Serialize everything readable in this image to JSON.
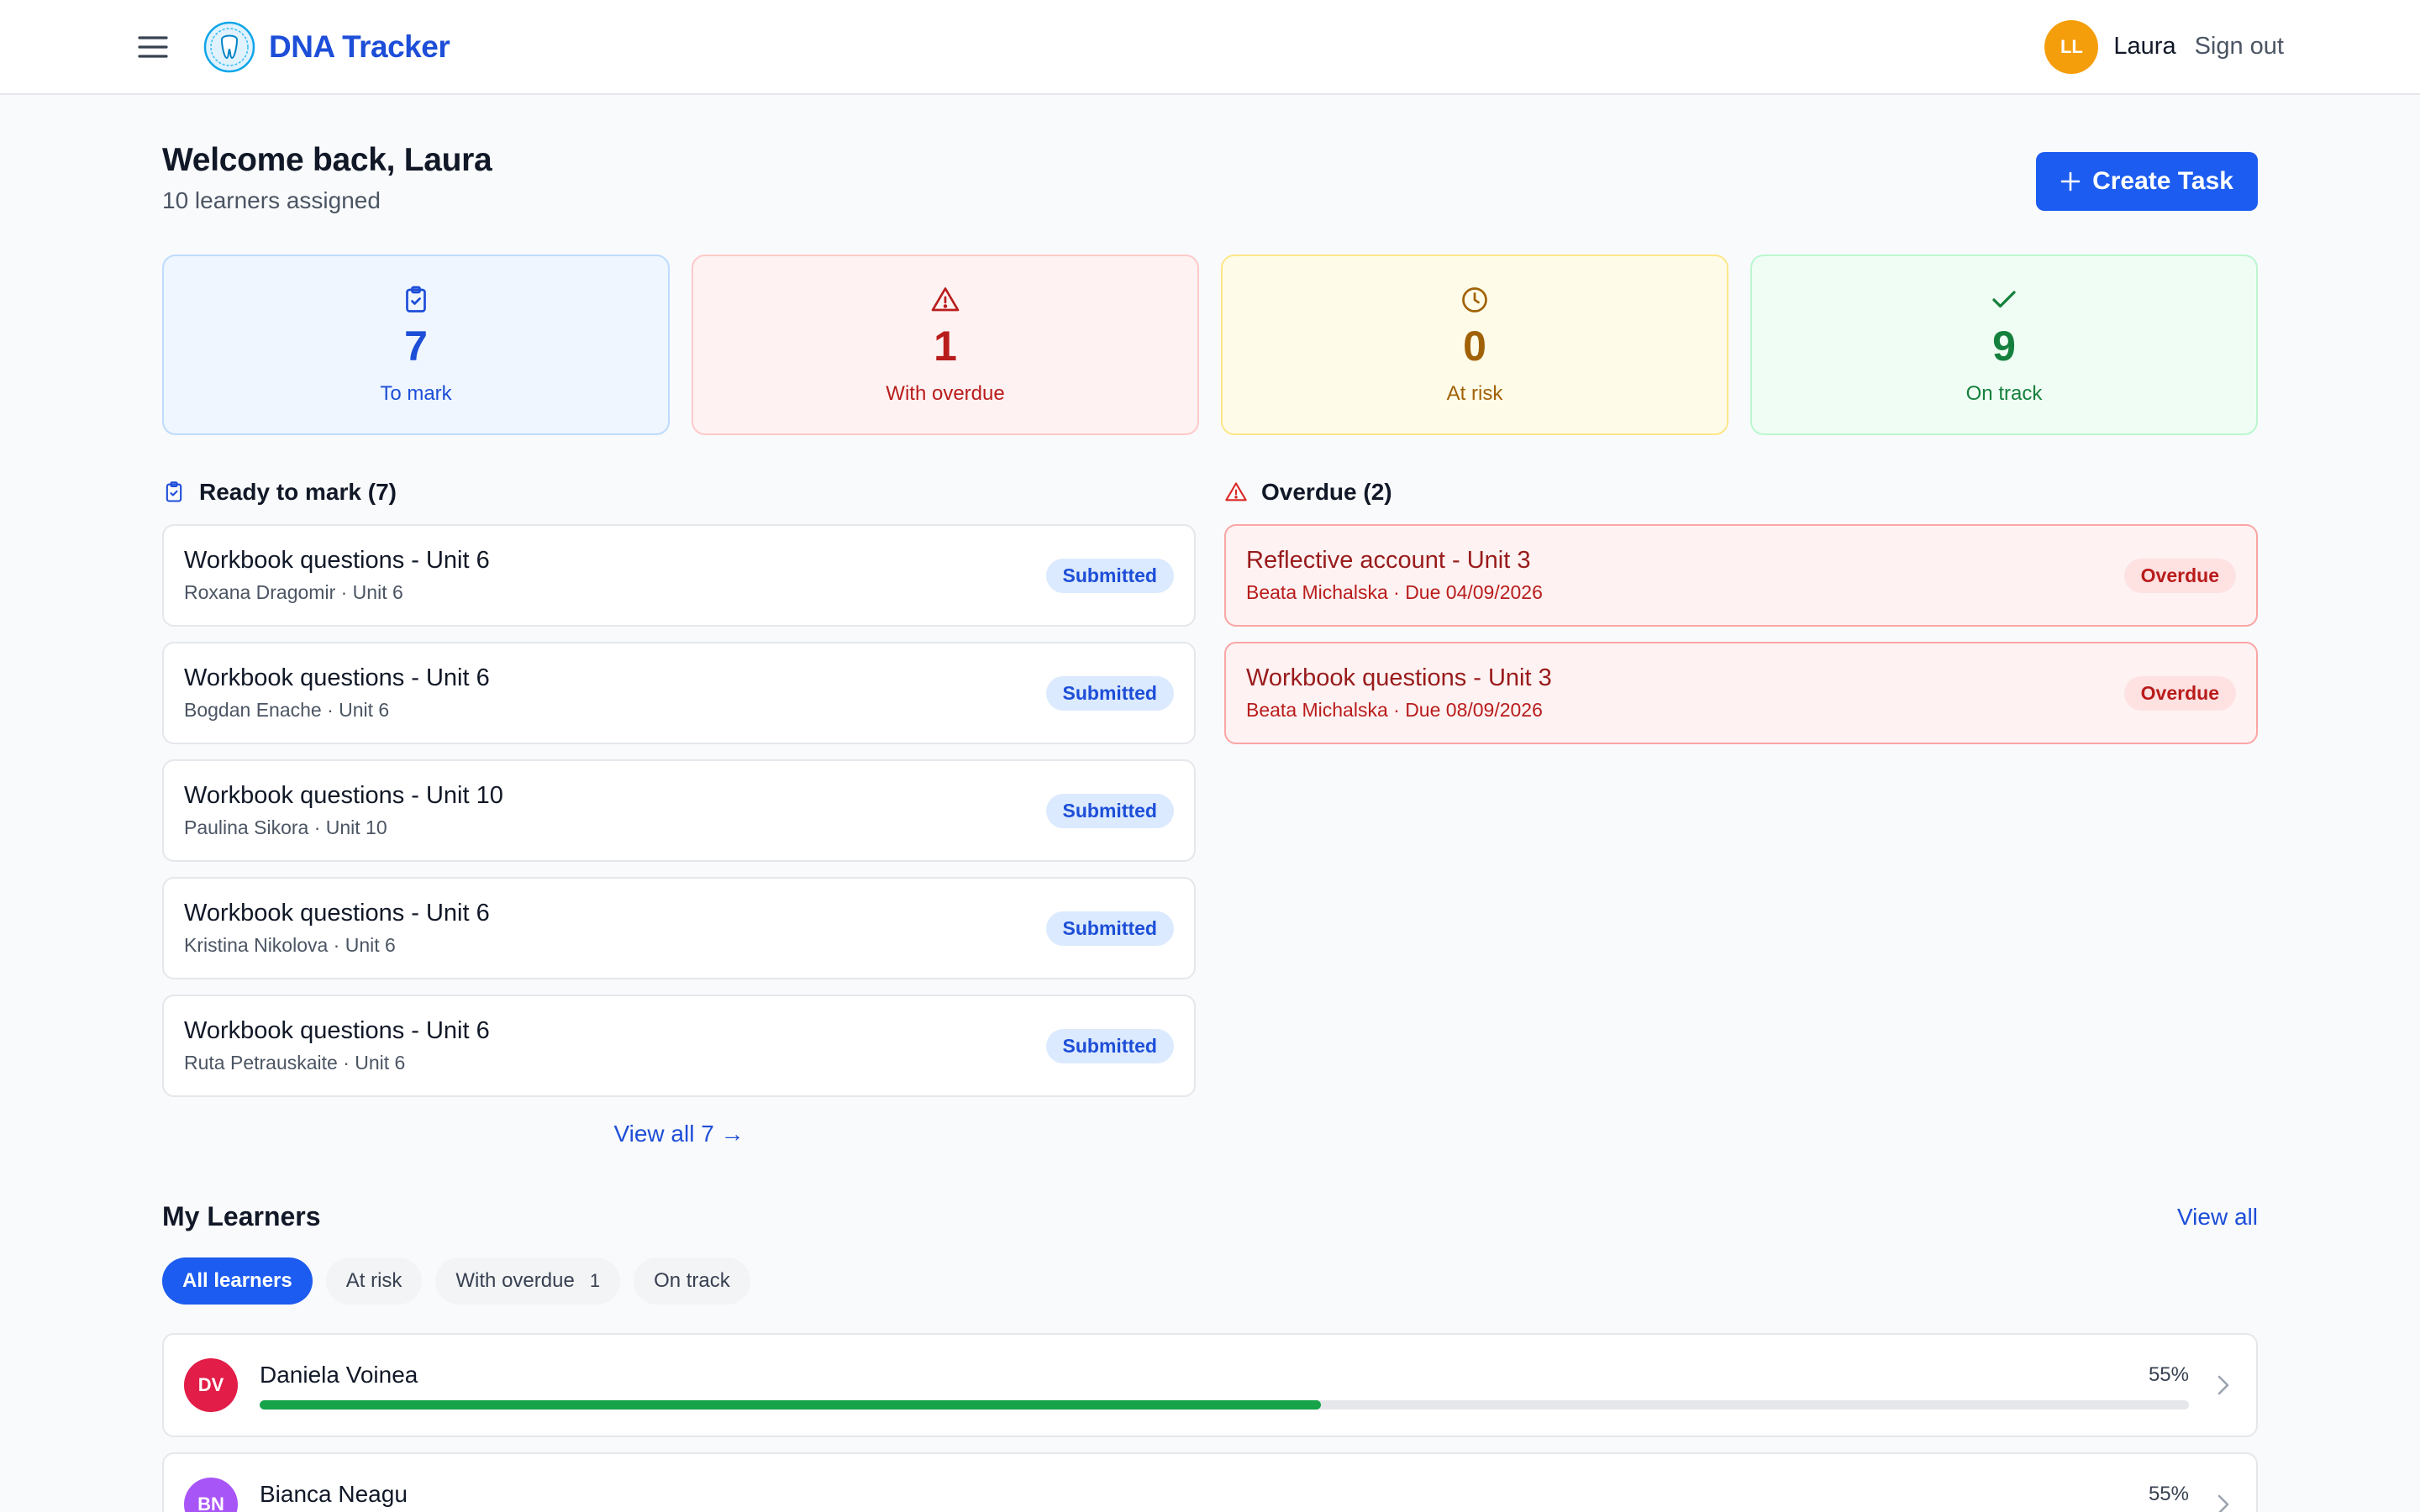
{
  "app": {
    "title": "DNA Tracker"
  },
  "user": {
    "initials": "LL",
    "name": "Laura",
    "signout_label": "Sign out",
    "avatar_color": "#f59e0b"
  },
  "welcome": {
    "title": "Welcome back, Laura",
    "subtitle": "10 learners assigned",
    "create_label": "Create Task"
  },
  "stats": [
    {
      "value": "7",
      "label": "To mark",
      "icon": "clipboard-check-icon",
      "color": "#1d4ed8"
    },
    {
      "value": "1",
      "label": "With overdue",
      "icon": "warning-triangle-icon",
      "color": "#b91c1c"
    },
    {
      "value": "0",
      "label": "At risk",
      "icon": "clock-icon",
      "color": "#a16207"
    },
    {
      "value": "9",
      "label": "On track",
      "icon": "checkmark-icon",
      "color": "#15803d"
    }
  ],
  "ready": {
    "title": "Ready to mark (7)",
    "items": [
      {
        "title": "Workbook questions - Unit 6",
        "meta": "Roxana Dragomir · Unit 6",
        "status": "Submitted"
      },
      {
        "title": "Workbook questions - Unit 6",
        "meta": "Bogdan Enache · Unit 6",
        "status": "Submitted"
      },
      {
        "title": "Workbook questions - Unit 10",
        "meta": "Paulina Sikora · Unit 10",
        "status": "Submitted"
      },
      {
        "title": "Workbook questions - Unit 6",
        "meta": "Kristina Nikolova · Unit 6",
        "status": "Submitted"
      },
      {
        "title": "Workbook questions - Unit 6",
        "meta": "Ruta Petrauskaite · Unit 6",
        "status": "Submitted"
      }
    ],
    "view_all_label": "View all 7 →"
  },
  "overdue": {
    "title": "Overdue (2)",
    "items": [
      {
        "title": "Reflective account - Unit 3",
        "meta": "Beata Michalska · Due 04/09/2026",
        "status": "Overdue"
      },
      {
        "title": "Workbook questions - Unit 3",
        "meta": "Beata Michalska · Due 08/09/2026",
        "status": "Overdue"
      }
    ]
  },
  "learners": {
    "title": "My Learners",
    "view_all_label": "View all",
    "filters": [
      {
        "label": "All learners",
        "count": null,
        "active": true
      },
      {
        "label": "At risk",
        "count": null,
        "active": false
      },
      {
        "label": "With overdue",
        "count": "1",
        "active": false
      },
      {
        "label": "On track",
        "count": null,
        "active": false
      }
    ],
    "items": [
      {
        "initials": "DV",
        "name": "Daniela Voinea",
        "progress_label": "55%",
        "progress": 0.55,
        "avatar_color": "#e11d48"
      },
      {
        "initials": "BN",
        "name": "Bianca Neagu",
        "progress_label": "55%",
        "progress": 0.55,
        "avatar_color": "#a855f7"
      }
    ]
  },
  "colors": {
    "primary": "#1d5cf0",
    "progress": "#16a34a"
  }
}
